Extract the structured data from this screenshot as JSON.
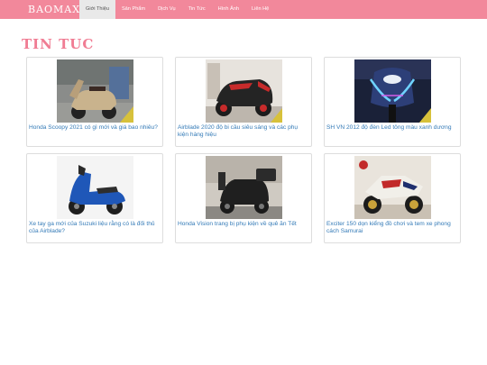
{
  "navbar": {
    "brand": "BAOMAX",
    "items": [
      {
        "label": "Giới Thiệu",
        "active": true
      },
      {
        "label": "Sản Phẩm",
        "active": false
      },
      {
        "label": "Dịch Vụ",
        "active": false
      },
      {
        "label": "Tin Tức",
        "active": false
      },
      {
        "label": "Hình Ảnh",
        "active": false
      },
      {
        "label": "Liên Hệ",
        "active": false
      }
    ],
    "color": "#f2889b"
  },
  "main": {
    "title": "TIN TUC",
    "title_color": "#f07c93",
    "link_color": "#337ab7",
    "articles": [
      {
        "title": "Honda Scoopy 2021 có gì mới và giá bao nhiêu?",
        "image": "scooter-cream-photo"
      },
      {
        "title": "Airblade 2020 độ bi cầu siêu sáng và các phụ kiện hàng hiệu",
        "image": "scooter-black-red-photo"
      },
      {
        "title": "SH VN 2012 độ đèn Led tông màu xanh dương",
        "image": "scooter-blue-led-photo"
      },
      {
        "title": "Xe tay ga mới của Suzuki liệu rằng có là đối thủ của Airblade?",
        "image": "scooter-blue-photo"
      },
      {
        "title": "Honda Vision trang bị phụ kiện về quê ăn Tết",
        "image": "scooter-black-rack-photo"
      },
      {
        "title": "Exciter 150 dọn kiểng đồ chơi và tem xe phong cách Samurai",
        "image": "motorbike-samurai-photo"
      }
    ]
  }
}
